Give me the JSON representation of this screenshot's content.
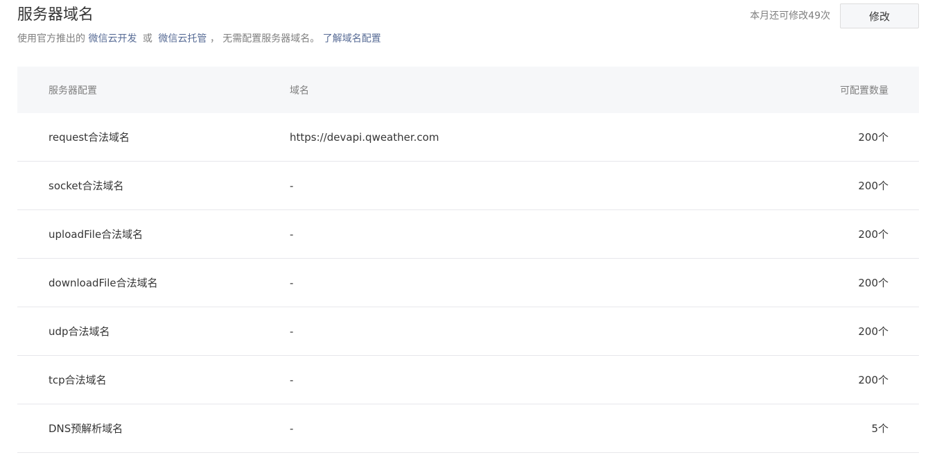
{
  "header": {
    "title": "服务器域名",
    "subtitle_prefix": "使用官方推出的",
    "link_cloud_dev": "微信云开发",
    "subtitle_or": "或",
    "link_cloud_hosting": "微信云托管",
    "subtitle_suffix": "，  无需配置服务器域名。",
    "link_learn": "了解域名配置",
    "quota_text": "本月还可修改49次",
    "modify_label": "修改"
  },
  "table": {
    "columns": {
      "config": "服务器配置",
      "domain": "域名",
      "count": "可配置数量"
    },
    "rows": [
      {
        "config": "request合法域名",
        "domain": "https://devapi.qweather.com",
        "count": "200个"
      },
      {
        "config": "socket合法域名",
        "domain": "-",
        "count": "200个"
      },
      {
        "config": "uploadFile合法域名",
        "domain": "-",
        "count": "200个"
      },
      {
        "config": "downloadFile合法域名",
        "domain": "-",
        "count": "200个"
      },
      {
        "config": "udp合法域名",
        "domain": "-",
        "count": "200个"
      },
      {
        "config": "tcp合法域名",
        "domain": "-",
        "count": "200个"
      },
      {
        "config": "DNS预解析域名",
        "domain": "-",
        "count": "5个"
      }
    ]
  },
  "colors": {
    "link": "#576b95",
    "text": "#353535",
    "muted": "#7f7f7f",
    "table_head_bg": "#f6f7f9",
    "border": "#e7e7eb"
  }
}
